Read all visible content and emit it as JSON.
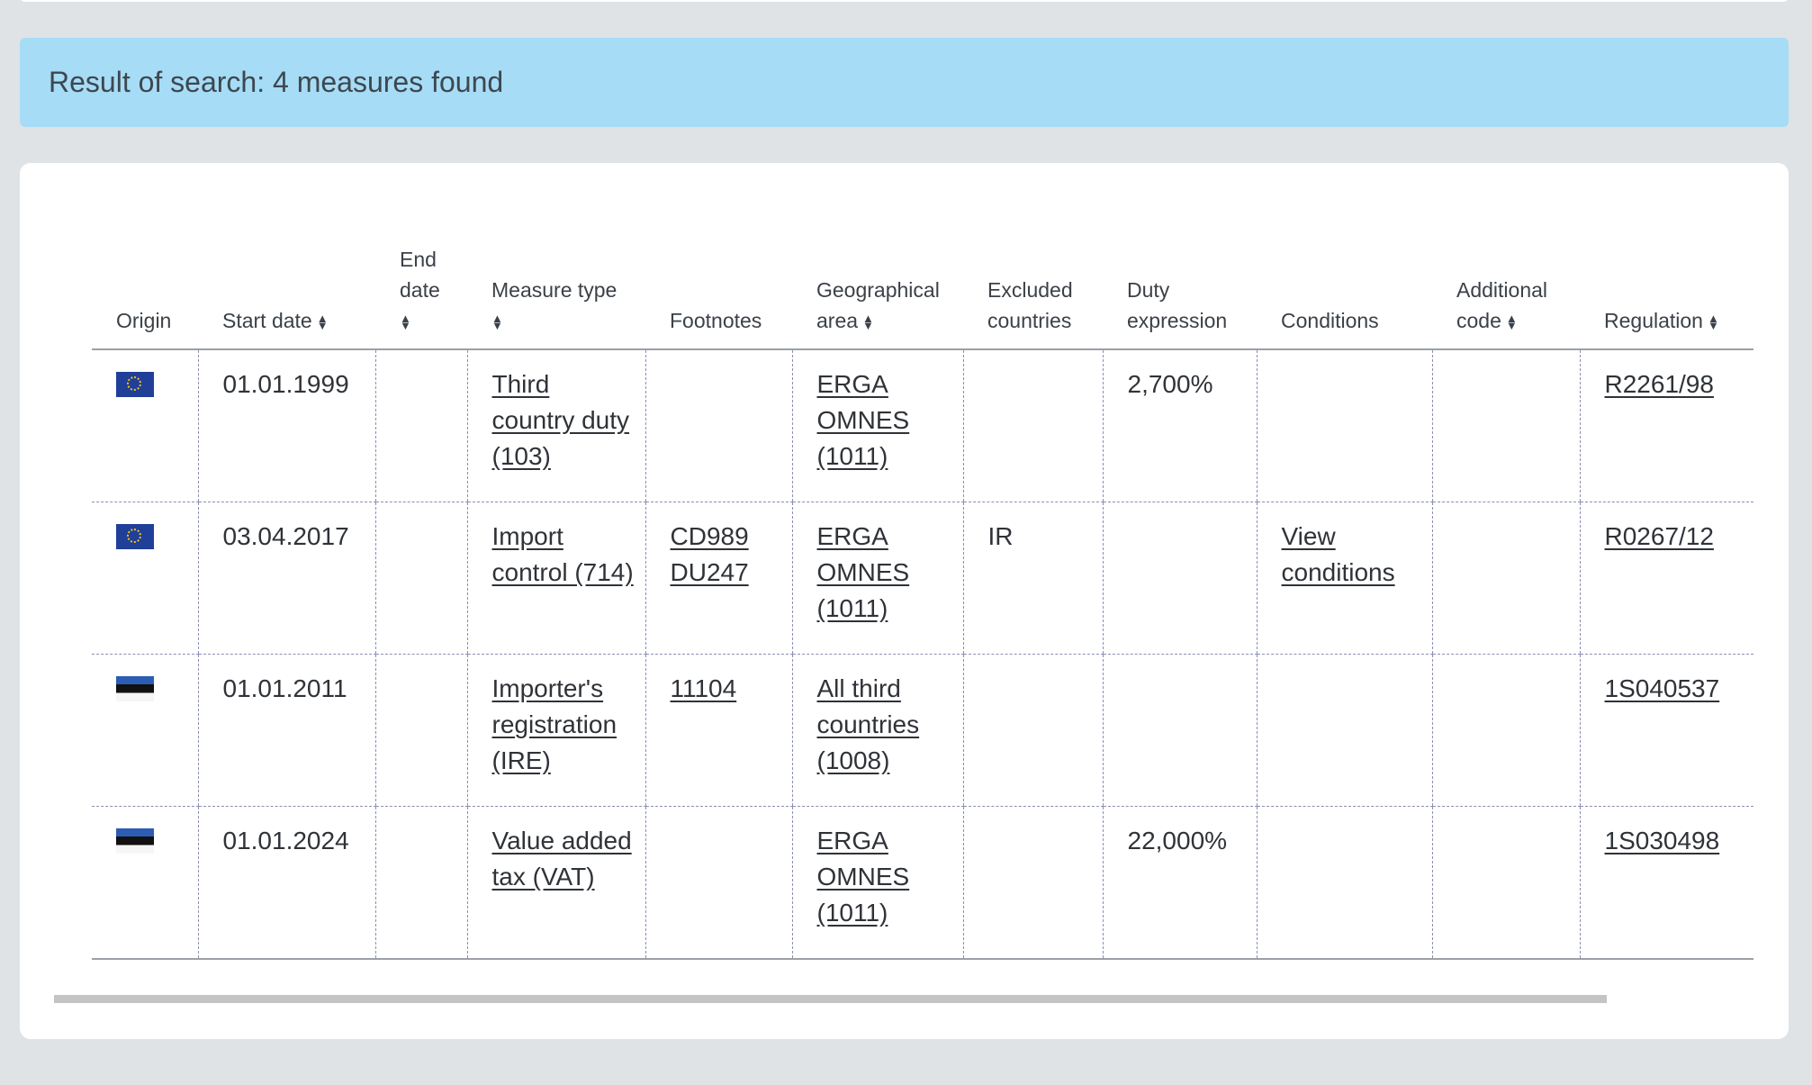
{
  "banner": {
    "text": "Result of search: 4 measures found"
  },
  "table": {
    "headers": {
      "origin": "Origin",
      "start_date": "Start date",
      "end_date": "End date",
      "measure_type": "Measure type",
      "footnotes": "Footnotes",
      "geographical_area": "Geographical area",
      "excluded_countries": "Excluded countries",
      "duty_expression": "Duty expression",
      "conditions": "Conditions",
      "additional_code": "Additional code",
      "regulation": "Regulation"
    },
    "sort_icon": "sort-up-down-icon",
    "rows": [
      {
        "origin_flag": "eu-flag-icon",
        "start_date": "01.01.1999",
        "end_date": "",
        "measure_type": "Third country duty (103)",
        "footnotes": [
          "",
          ""
        ],
        "geographical_area": "ERGA OMNES (1011)",
        "excluded_countries": "",
        "duty_expression": "2,700%",
        "conditions": "",
        "additional_code": "",
        "regulation": "R2261/98"
      },
      {
        "origin_flag": "eu-flag-icon",
        "start_date": "03.04.2017",
        "end_date": "",
        "measure_type": "Import control (714)",
        "footnotes": [
          "CD989",
          "DU247"
        ],
        "geographical_area": "ERGA OMNES (1011)",
        "excluded_countries": "IR",
        "duty_expression": "",
        "conditions": "View conditions",
        "additional_code": "",
        "regulation": "R0267/12"
      },
      {
        "origin_flag": "estonia-flag-icon",
        "start_date": "01.01.2011",
        "end_date": "",
        "measure_type": "Importer's registration (IRE)",
        "footnotes": [
          "11104",
          ""
        ],
        "geographical_area": "All third countries (1008)",
        "excluded_countries": "",
        "duty_expression": "",
        "conditions": "",
        "additional_code": "",
        "regulation": "1S040537"
      },
      {
        "origin_flag": "estonia-flag-icon",
        "start_date": "01.01.2024",
        "end_date": "",
        "measure_type": "Value added tax (VAT)",
        "footnotes": [
          "",
          ""
        ],
        "geographical_area": "ERGA OMNES (1011)",
        "excluded_countries": "",
        "duty_expression": "22,000%",
        "conditions": "",
        "additional_code": "",
        "regulation": "1S030498"
      }
    ]
  },
  "colors": {
    "page_background": "#dfe3e6",
    "banner_background": "#a6dcf5",
    "row_divider": "#8a8fb5"
  }
}
